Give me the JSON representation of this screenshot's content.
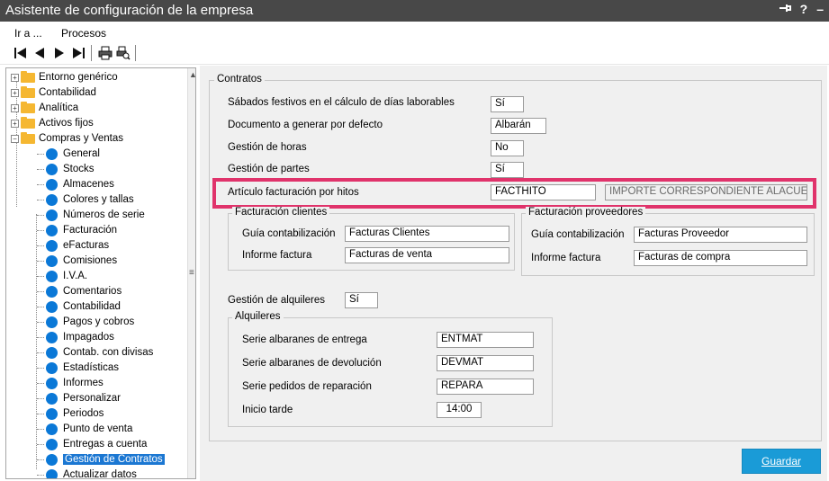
{
  "window": {
    "title": "Asistente de configuración de la empresa",
    "pin_icon": "pin-icon",
    "help": "?",
    "minimize": "–"
  },
  "menu": {
    "goto": "Ir a ...",
    "processes": "Procesos"
  },
  "tree": {
    "items": [
      {
        "label": "Entorno genérico",
        "type": "folder"
      },
      {
        "label": "Contabilidad",
        "type": "folder"
      },
      {
        "label": "Analítica",
        "type": "folder"
      },
      {
        "label": "Activos fijos",
        "type": "folder"
      },
      {
        "label": "Compras y Ventas",
        "type": "folder-open"
      },
      {
        "label": "General",
        "type": "leaf"
      },
      {
        "label": "Stocks",
        "type": "leaf"
      },
      {
        "label": "Almacenes",
        "type": "leaf"
      },
      {
        "label": "Colores y tallas",
        "type": "leaf"
      },
      {
        "label": "Números de serie",
        "type": "leaf"
      },
      {
        "label": "Facturación",
        "type": "leaf"
      },
      {
        "label": "eFacturas",
        "type": "leaf"
      },
      {
        "label": "Comisiones",
        "type": "leaf"
      },
      {
        "label": "I.V.A.",
        "type": "leaf"
      },
      {
        "label": "Comentarios",
        "type": "leaf"
      },
      {
        "label": "Contabilidad",
        "type": "leaf"
      },
      {
        "label": "Pagos y cobros",
        "type": "leaf"
      },
      {
        "label": "Impagados",
        "type": "leaf"
      },
      {
        "label": "Contab. con divisas",
        "type": "leaf"
      },
      {
        "label": "Estadísticas",
        "type": "leaf"
      },
      {
        "label": "Informes",
        "type": "leaf"
      },
      {
        "label": "Personalizar",
        "type": "leaf"
      },
      {
        "label": "Periodos",
        "type": "leaf"
      },
      {
        "label": "Punto de venta",
        "type": "leaf"
      },
      {
        "label": "Entregas a cuenta",
        "type": "leaf"
      },
      {
        "label": "Gestión de Contratos",
        "type": "leaf-selected"
      },
      {
        "label": "Actualizar datos",
        "type": "leaf"
      }
    ]
  },
  "contracts": {
    "legend": "Contratos",
    "saturdays_label": "Sábados festivos en el cálculo de días laborables",
    "saturdays_value": "Sí",
    "document_label": "Documento a generar por defecto",
    "document_value": "Albarán",
    "hours_label": "Gestión de horas",
    "hours_value": "No",
    "parts_label": "Gestión de partes",
    "parts_value": "Sí",
    "milestone_label": "Artículo facturación por hitos",
    "milestone_value": "FACTHITO",
    "milestone_desc": "IMPORTE CORRESPONDIENTE ALACUERDO",
    "clients": {
      "legend": "Facturación clientes",
      "guide_label": "Guía contabilización",
      "guide_value": "Facturas Clientes",
      "report_label": "Informe factura",
      "report_value": "Facturas de venta"
    },
    "suppliers": {
      "legend": "Facturación proveedores",
      "guide_label": "Guía contabilización",
      "guide_value": "Facturas Proveedor",
      "report_label": "Informe factura",
      "report_value": "Facturas de compra"
    },
    "rentals_label": "Gestión de alquileres",
    "rentals_value": "Sí",
    "rentals": {
      "legend": "Alquileres",
      "delivery_label": "Serie albaranes de entrega",
      "delivery_value": "ENTMAT",
      "return_label": "Serie albaranes de devolución",
      "return_value": "DEVMAT",
      "repair_label": "Serie pedidos de reparación",
      "repair_value": "REPARA",
      "late_label": "Inicio tarde",
      "late_value": "14:00"
    }
  },
  "buttons": {
    "save": "Guardar"
  },
  "colors": {
    "title_bg": "#484848",
    "selection": "#1b77d2",
    "highlight": "#e0336b",
    "save_bg": "#1a9bd7"
  }
}
